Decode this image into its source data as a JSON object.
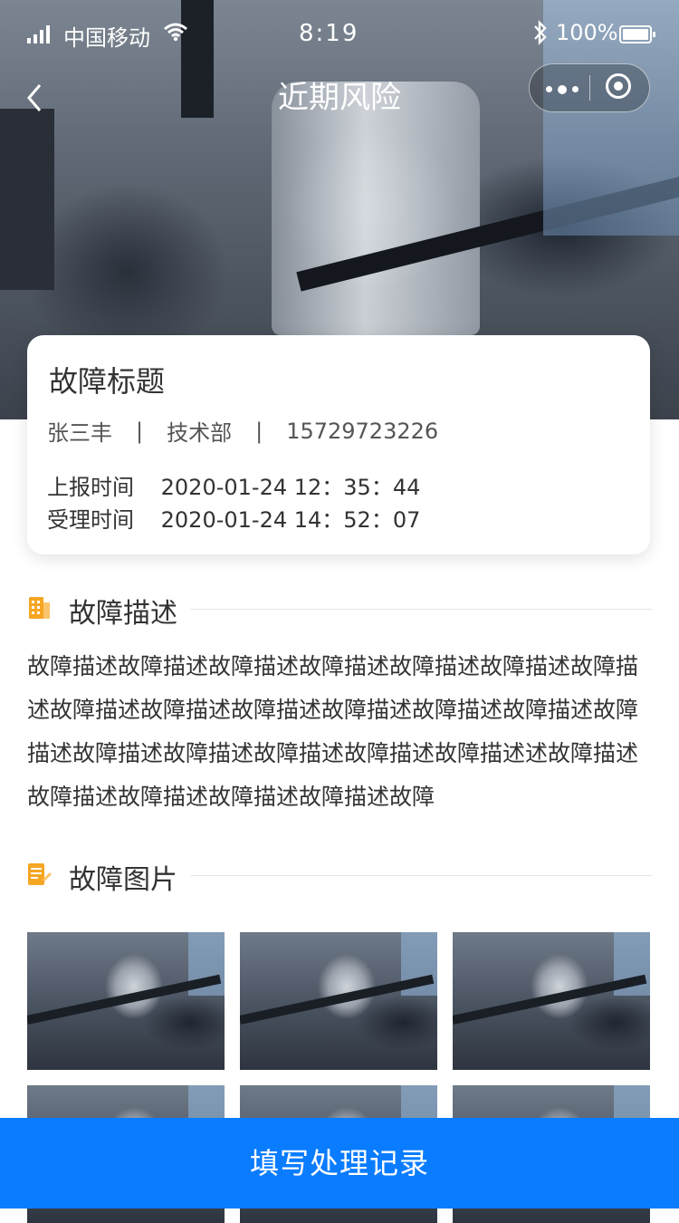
{
  "status": {
    "carrier": "中国移动",
    "time": "8:19",
    "battery": "100%"
  },
  "nav": {
    "title": "近期风险"
  },
  "card": {
    "title": "故障标题",
    "reporter": "张三丰",
    "department": "技术部",
    "phone": "15729723226",
    "report_label": "上报时间",
    "report_time": "2020-01-24 12：35：44",
    "accept_label": "受理时间",
    "accept_time": "2020-01-24 14：52：07"
  },
  "description": {
    "heading": "故障描述",
    "text": "故障描述故障描述故障描述故障描述故障描述故障描述故障描述故障描述故障描述故障描述故障描述故障描述故障描述故障描述故障描述故障描述故障描述故障描述故障描述述故障描述故障描述故障描述故障描述故障描述故障"
  },
  "pictures": {
    "heading": "故障图片",
    "count": 6
  },
  "bottom_button": "填写处理记录",
  "colors": {
    "primary": "#0a7cff",
    "section_icon": "#f5a623"
  }
}
